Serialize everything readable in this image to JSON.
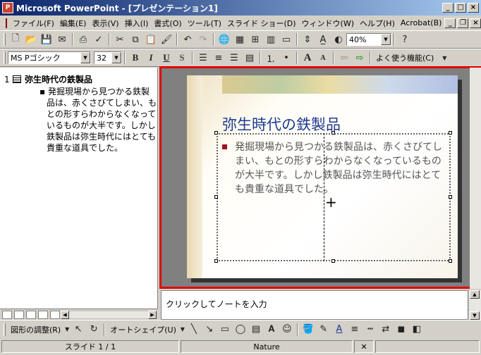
{
  "window": {
    "title": "Microsoft PowerPoint - [プレゼンテーション1]",
    "app_icon_letter": "P",
    "min": "_",
    "max": "□",
    "close": "×"
  },
  "menu": {
    "items": [
      "ファイル(F)",
      "編集(E)",
      "表示(V)",
      "挿入(I)",
      "書式(O)",
      "ツール(T)",
      "スライド ショー(D)",
      "ウィンドウ(W)",
      "ヘルプ(H)",
      "Acrobat(B)"
    ],
    "child_min": "_",
    "child_restore": "❐",
    "child_close": "×"
  },
  "standard_toolbar": {
    "zoom": "40%",
    "help_icon": "?"
  },
  "format_toolbar": {
    "font": "MS Pゴシック",
    "size": "32",
    "bold": "B",
    "italic": "I",
    "underline": "U",
    "shadow": "S",
    "grow_font": "A",
    "shrink_font": "A",
    "common_tasks": "よく使う機能(C)"
  },
  "outline": {
    "slide_number": "1",
    "title": "弥生時代の鉄製品",
    "body": "発掘現場から見つかる鉄製品は、赤くさびてしまい、もとの形すらわからなくなっているものが大半です。しかし鉄製品は弥生時代にはとても貴重な道具でした。"
  },
  "slide": {
    "title": "弥生時代の鉄製品",
    "body": "発掘現場から見つかる鉄製品は、赤くさびてしまい、もとの形すらわからなくなっているものが大半です。しかし鉄製品は弥生時代にはとても貴重な道具でした。"
  },
  "notes": {
    "placeholder": "クリックしてノートを入力"
  },
  "drawing_toolbar": {
    "draw_menu": "図形の調整(R)",
    "autoshapes": "オートシェイプ(U)"
  },
  "status": {
    "slide_indicator": "スライド 1 / 1",
    "design": "Nature"
  },
  "colors": {
    "slide_pane_border": "#e00000",
    "slide_title": "#1f3a8f",
    "bullet": "#a01020"
  }
}
